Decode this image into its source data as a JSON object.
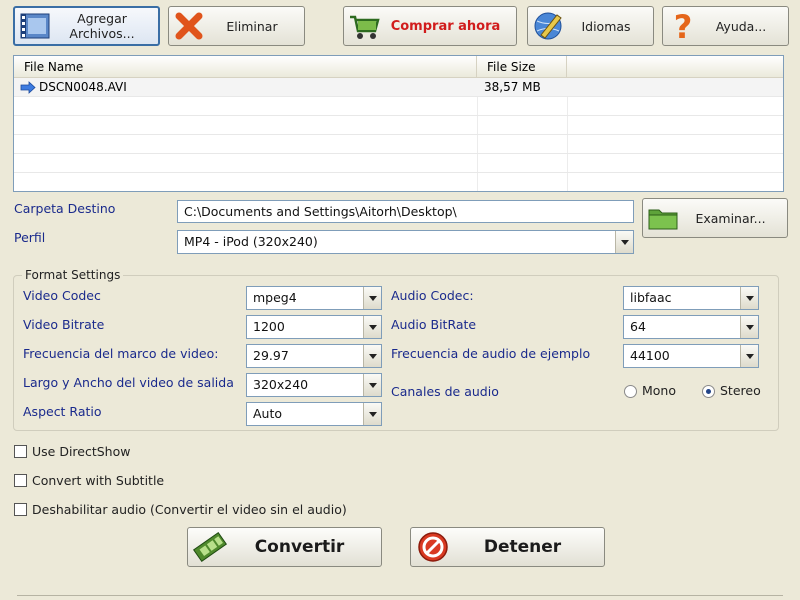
{
  "toolbar": {
    "add_files": "Agregar Archivos...",
    "delete": "Eliminar",
    "buy_now": "Comprar ahora",
    "languages": "Idiomas",
    "help": "Ayuda..."
  },
  "filelist": {
    "col_name": "File Name",
    "col_size": "File Size",
    "rows": [
      {
        "name": "DSCN0048.AVI",
        "size": "38,57 MB"
      }
    ]
  },
  "output": {
    "dest_label": "Carpeta Destino",
    "dest_value": "C:\\Documents and Settings\\Aitorh\\Desktop\\",
    "browse": "Examinar...",
    "profile_label": "Perfil",
    "profile_value": "MP4 - iPod (320x240)"
  },
  "format": {
    "title": "Format Settings",
    "video_codec_label": "Video Codec",
    "video_codec": "mpeg4",
    "video_bitrate_label": "Video Bitrate",
    "video_bitrate": "1200",
    "frame_rate_label": "Frecuencia del marco de video:",
    "frame_rate": "29.97",
    "size_label": "Largo y Ancho del video de salida",
    "size": "320x240",
    "aspect_label": "Aspect Ratio",
    "aspect": "Auto",
    "audio_codec_label": "Audio Codec:",
    "audio_codec": "libfaac",
    "audio_bitrate_label": "Audio BitRate",
    "audio_bitrate": "64",
    "sample_rate_label": "Frecuencia de audio de ejemplo",
    "sample_rate": "44100",
    "channels_label": "Canales de audio",
    "mono": "Mono",
    "stereo": "Stereo",
    "channels_selected": "Stereo"
  },
  "options": {
    "directshow": "Use DirectShow",
    "subtitle": "Convert with Subtitle",
    "disable_audio": "Deshabilitar audio (Convertir el video sin el audio)"
  },
  "actions": {
    "convert": "Convertir",
    "stop": "Detener"
  },
  "colors": {
    "label_blue": "#1a2a8c",
    "buy_red": "#d11c1c",
    "window_bg": "#ece9d8"
  }
}
